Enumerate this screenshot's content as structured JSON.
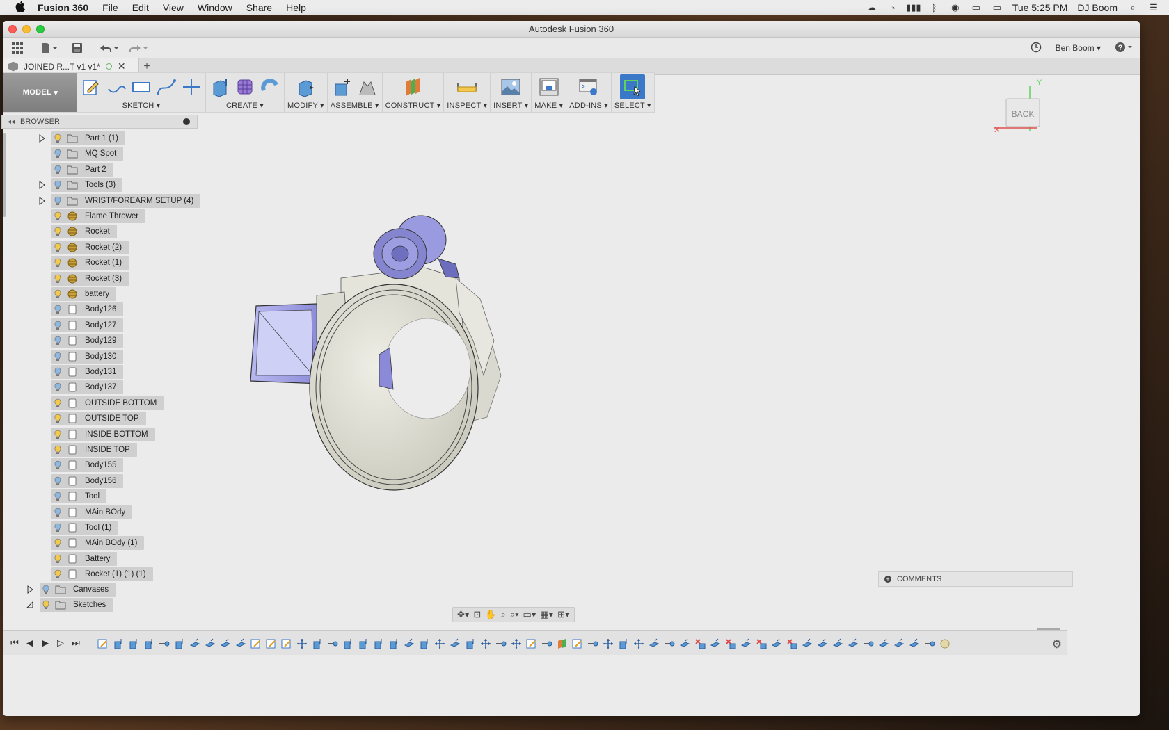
{
  "menubar": {
    "app_name": "Fusion 360",
    "items": [
      "File",
      "Edit",
      "View",
      "Window",
      "Share",
      "Help"
    ],
    "clock": "Tue 5:25 PM",
    "user": "DJ Boom"
  },
  "window": {
    "title": "Autodesk Fusion 360"
  },
  "qat": {
    "user_name": "Ben Boom"
  },
  "doc_tab": {
    "name": "JOINED R...T v1 v1*"
  },
  "ribbon": {
    "workspace": "MODEL",
    "groups": [
      "SKETCH",
      "CREATE",
      "MODIFY",
      "ASSEMBLE",
      "CONSTRUCT",
      "INSPECT",
      "INSERT",
      "MAKE",
      "ADD-INS",
      "SELECT"
    ]
  },
  "browser": {
    "title": "BROWSER",
    "items": [
      {
        "label": "Part 1 (1)",
        "type": "folder",
        "expandable": true,
        "light": "on"
      },
      {
        "label": "MQ Spot",
        "type": "folder",
        "expandable": false,
        "light": "off"
      },
      {
        "label": "Part 2",
        "type": "folder",
        "expandable": false,
        "light": "off"
      },
      {
        "label": "Tools (3)",
        "type": "folder",
        "expandable": true,
        "light": "off"
      },
      {
        "label": "WRIST/FOREARM SETUP (4)",
        "type": "folder",
        "expandable": true,
        "light": "off"
      },
      {
        "label": "Flame Thrower",
        "type": "component",
        "expandable": false,
        "light": "on"
      },
      {
        "label": "Rocket",
        "type": "component",
        "expandable": false,
        "light": "on"
      },
      {
        "label": "Rocket (2)",
        "type": "component",
        "expandable": false,
        "light": "on"
      },
      {
        "label": "Rocket (1)",
        "type": "component",
        "expandable": false,
        "light": "on"
      },
      {
        "label": "Rocket (3)",
        "type": "component",
        "expandable": false,
        "light": "on"
      },
      {
        "label": "battery",
        "type": "component",
        "expandable": false,
        "light": "on"
      },
      {
        "label": "Body126",
        "type": "body",
        "expandable": false,
        "light": "off"
      },
      {
        "label": "Body127",
        "type": "body",
        "expandable": false,
        "light": "off"
      },
      {
        "label": "Body129",
        "type": "body",
        "expandable": false,
        "light": "off"
      },
      {
        "label": "Body130",
        "type": "body",
        "expandable": false,
        "light": "off"
      },
      {
        "label": "Body131",
        "type": "body",
        "expandable": false,
        "light": "off"
      },
      {
        "label": "Body137",
        "type": "body",
        "expandable": false,
        "light": "off"
      },
      {
        "label": "OUTSIDE BOTTOM",
        "type": "body",
        "expandable": false,
        "light": "on"
      },
      {
        "label": "OUTSIDE TOP",
        "type": "body",
        "expandable": false,
        "light": "on"
      },
      {
        "label": "INSIDE BOTTOM",
        "type": "body",
        "expandable": false,
        "light": "on"
      },
      {
        "label": "INSIDE TOP",
        "type": "body",
        "expandable": false,
        "light": "on"
      },
      {
        "label": "Body155",
        "type": "body",
        "expandable": false,
        "light": "off"
      },
      {
        "label": "Body156",
        "type": "body",
        "expandable": false,
        "light": "off"
      },
      {
        "label": "Tool",
        "type": "body",
        "expandable": false,
        "light": "off"
      },
      {
        "label": "MAin BOdy",
        "type": "body",
        "expandable": false,
        "light": "off"
      },
      {
        "label": "Tool (1)",
        "type": "body",
        "expandable": false,
        "light": "off"
      },
      {
        "label": "MAin BOdy (1)",
        "type": "body",
        "expandable": false,
        "light": "on"
      },
      {
        "label": "Battery",
        "type": "body",
        "expandable": false,
        "light": "on"
      },
      {
        "label": "Rocket (1) (1) (1)",
        "type": "body",
        "expandable": false,
        "light": "on"
      }
    ],
    "root_items": [
      {
        "label": "Canvases",
        "expandable": true,
        "light": "off",
        "state": "collapsed"
      },
      {
        "label": "Sketches",
        "expandable": true,
        "light": "on",
        "state": "expanded"
      }
    ]
  },
  "viewcube": {
    "face": "BACK",
    "axis_x": "X",
    "axis_y": "Y"
  },
  "comments": {
    "label": "COMMENTS"
  },
  "colors": {
    "accent_blue": "#3c78c8",
    "bulb_on": "#f2c94c",
    "bulb_off": "#8fb8e0",
    "component_gold": "#c9a13c"
  }
}
